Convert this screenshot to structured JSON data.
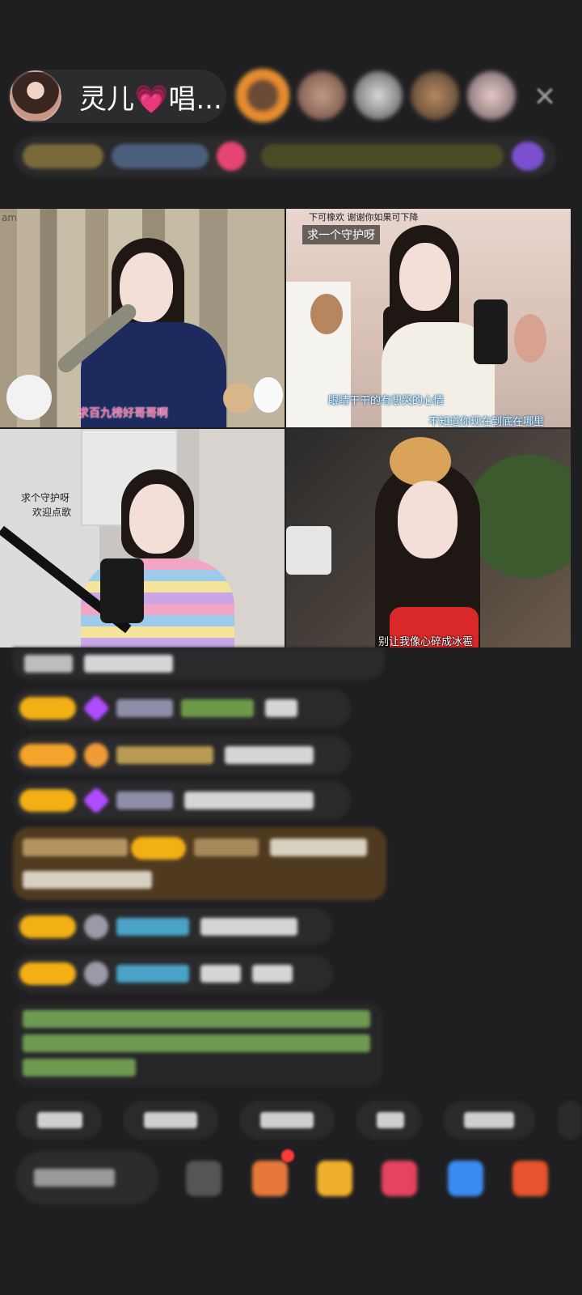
{
  "header": {
    "host_name": "灵儿💗唱...",
    "close_symbol": "✕"
  },
  "videos": {
    "tile1": {
      "watermark": "am",
      "caption": "求百九榜好哥哥啊"
    },
    "tile2": {
      "top_note": "下可橡欢 谢谢你如果可下降",
      "tag": "求一个守护呀",
      "caption1": "眼睛干干的有想哭的心情",
      "caption2": "不知道你现在到底在哪里"
    },
    "tile3": {
      "note_line1": "求个守护呀",
      "note_line2": "欢迎点歌"
    },
    "tile4": {
      "caption": "别让我像心碎成冰雹"
    }
  },
  "colors": {
    "background": "#1f1f21",
    "panel": "#2a2a2c",
    "level_badge": "#f2b015",
    "gift_pink": "#e54570"
  }
}
